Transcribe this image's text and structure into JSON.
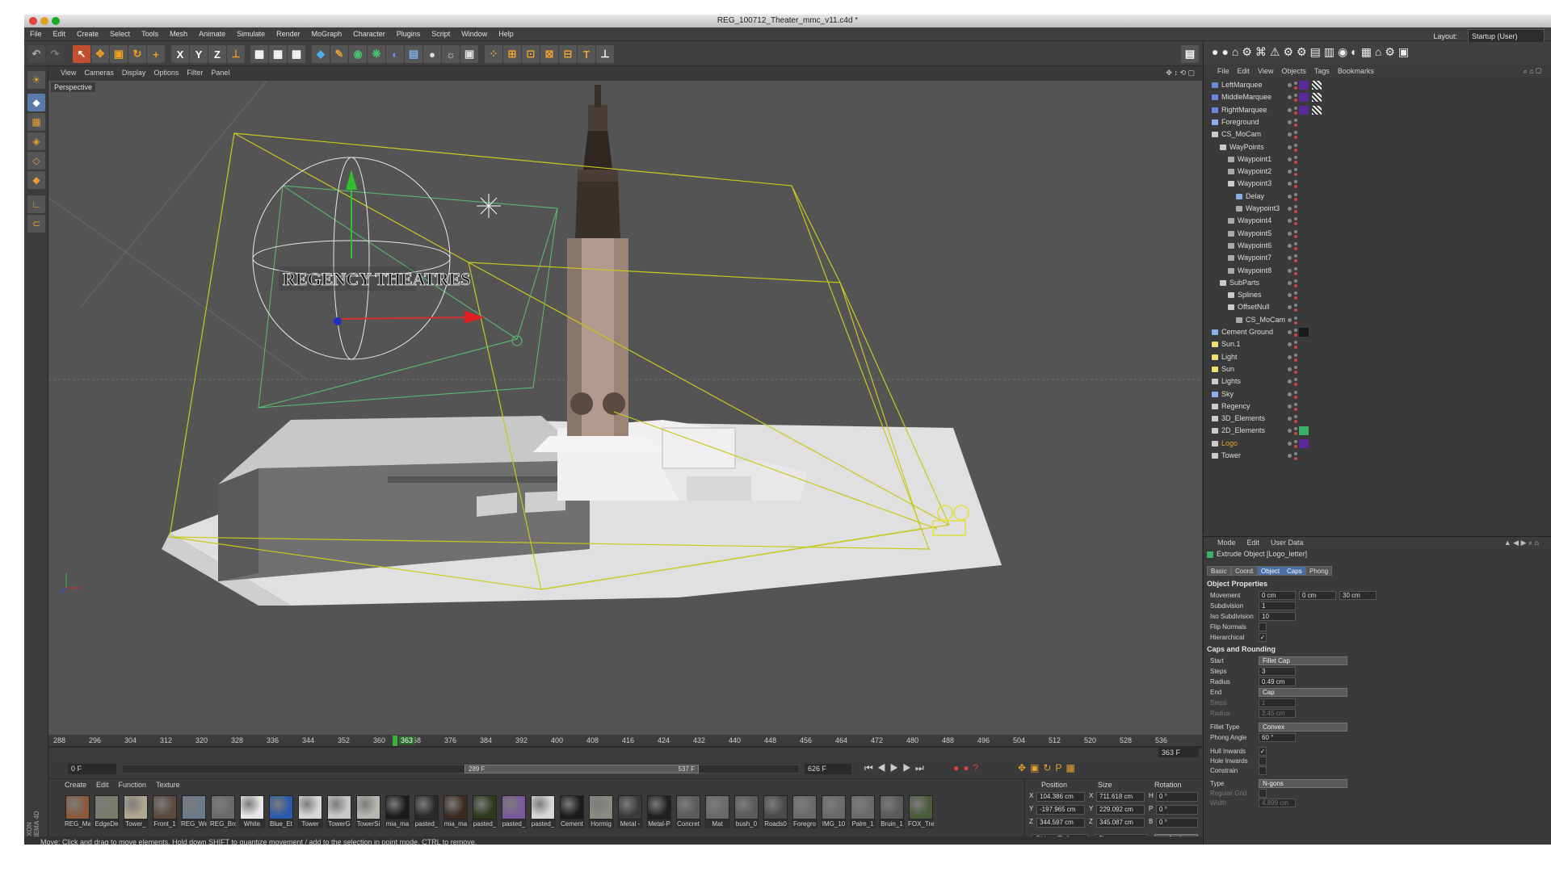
{
  "window": {
    "title": "REG_100712_Theater_mmc_v11.c4d *"
  },
  "menu": [
    "File",
    "Edit",
    "Create",
    "Select",
    "Tools",
    "Mesh",
    "Animate",
    "Simulate",
    "Render",
    "MoGraph",
    "Character",
    "Plugins",
    "Script",
    "Window",
    "Help"
  ],
  "layout": {
    "label": "Layout:",
    "value": "Startup (User)"
  },
  "toolbar": {
    "axis_x": "X",
    "axis_y": "Y",
    "axis_z": "Z",
    "text_tool": "T"
  },
  "viewport": {
    "menu": [
      "View",
      "Cameras",
      "Display",
      "Options",
      "Filter",
      "Panel"
    ],
    "label": "Perspective",
    "logo_text": "REGENCY THEATRES"
  },
  "timeline": {
    "ticks": [
      "288",
      "296",
      "304",
      "312",
      "320",
      "328",
      "336",
      "344",
      "352",
      "360",
      "368",
      "376",
      "384",
      "392",
      "400",
      "408",
      "416",
      "424",
      "432",
      "440",
      "448",
      "456",
      "464",
      "472",
      "480",
      "488",
      "496",
      "504",
      "512",
      "520",
      "528",
      "536"
    ],
    "current_marker": "363",
    "current_frame_display": "363 F",
    "frame_field": "0 F",
    "range_start": "289 F",
    "range_end": "537 F",
    "end_field": "626 F"
  },
  "materials": {
    "menu": [
      "Create",
      "Edit",
      "Function",
      "Texture"
    ],
    "brand": "MAXON CINEMA 4D",
    "items": [
      {
        "name": "REG_Ma",
        "color": "#8a5a3a"
      },
      {
        "name": "EdgeDe",
        "color": "#7a7a6a"
      },
      {
        "name": "Tower_",
        "color": "#b0a890"
      },
      {
        "name": "Front_1",
        "color": "#5a4a40"
      },
      {
        "name": "REG_We",
        "color": "#6a7a8a"
      },
      {
        "name": "REG_Brc",
        "color": "#6a6a6a"
      },
      {
        "name": "White",
        "color": "#e8e8e8"
      },
      {
        "name": "Blue_Et",
        "color": "#2a5aa8"
      },
      {
        "name": "Tower",
        "color": "#d8d8d8"
      },
      {
        "name": "TowerG",
        "color": "#c8c8c8"
      },
      {
        "name": "TowerSi",
        "color": "#b8b8b0"
      },
      {
        "name": "mia_ma",
        "color": "#1a1a1a"
      },
      {
        "name": "pasted_",
        "color": "#2a2a2a"
      },
      {
        "name": "mia_ma",
        "color": "#3a2a20"
      },
      {
        "name": "pasted_",
        "color": "#2a3a1a"
      },
      {
        "name": "pasted_",
        "color": "#7a5a9a"
      },
      {
        "name": "pasted_",
        "color": "#d8d8d8"
      },
      {
        "name": "Cement",
        "color": "#1a1a1a"
      },
      {
        "name": "Hormig",
        "color": "#8a8a80"
      },
      {
        "name": "Metal -",
        "color": "#3a3a3a"
      },
      {
        "name": "Metal-P",
        "color": "#202020"
      },
      {
        "name": "Concret",
        "color": "#5a5a5a"
      },
      {
        "name": "Mat",
        "color": "#6a6a6a"
      },
      {
        "name": "bush_0",
        "color": "#5a5a5a"
      },
      {
        "name": "Roads0",
        "color": "#4a4a4a"
      },
      {
        "name": "Foregro",
        "color": "#6a6a6a"
      },
      {
        "name": "IMG_10",
        "color": "#6a6a6a"
      },
      {
        "name": "Palm_1",
        "color": "#6a6a6a"
      },
      {
        "name": "Bruin_1",
        "color": "#5a5a5a"
      },
      {
        "name": "FOX_Tre",
        "color": "#4a5a3a"
      }
    ]
  },
  "coords": {
    "headers": [
      "Position",
      "Size",
      "Rotation"
    ],
    "rows": [
      {
        "axis": "X",
        "pos": "104.386 cm",
        "size_axis": "X",
        "size": "711.618 cm",
        "rot_axis": "H",
        "rot": "0 °"
      },
      {
        "axis": "Y",
        "pos": "-197.965 cm",
        "size_axis": "Y",
        "size": "229.092 cm",
        "rot_axis": "P",
        "rot": "0 °"
      },
      {
        "axis": "Z",
        "pos": "344.597 cm",
        "size_axis": "Z",
        "size": "345.087 cm",
        "rot_axis": "B",
        "rot": "0 °"
      }
    ],
    "mode": "Object (Rel)",
    "size_mode": "Size",
    "apply": "Apply"
  },
  "status": "Move: Click and drag to move elements. Hold down SHIFT to quantize movement / add to the selection in point mode, CTRL to remove.",
  "objects": {
    "menu": [
      "File",
      "Edit",
      "View",
      "Objects",
      "Tags",
      "Bookmarks"
    ],
    "rows": [
      {
        "name": "LeftMarquee",
        "indent": 0,
        "color": "#dcdcdc"
      },
      {
        "name": "MiddleMarquee",
        "indent": 0,
        "color": "#dcdcdc"
      },
      {
        "name": "RightMarquee",
        "indent": 0,
        "color": "#dcdcdc"
      },
      {
        "name": "Foreground",
        "indent": 0,
        "color": "#dcdcdc"
      },
      {
        "name": "CS_MoCam",
        "indent": 0,
        "color": "#dcdcdc"
      },
      {
        "name": "WayPoints",
        "indent": 1,
        "color": "#dcdcdc"
      },
      {
        "name": "Waypoint1",
        "indent": 2,
        "color": "#dcdcdc"
      },
      {
        "name": "Waypoint2",
        "indent": 2,
        "color": "#dcdcdc"
      },
      {
        "name": "Waypoint3",
        "indent": 2,
        "color": "#dcdcdc"
      },
      {
        "name": "Delay",
        "indent": 3,
        "color": "#dcdcdc"
      },
      {
        "name": "Waypoint3",
        "indent": 3,
        "color": "#dcdcdc"
      },
      {
        "name": "Waypoint4",
        "indent": 2,
        "color": "#dcdcdc"
      },
      {
        "name": "Waypoint5",
        "indent": 2,
        "color": "#dcdcdc"
      },
      {
        "name": "Waypoint6",
        "indent": 2,
        "color": "#dcdcdc"
      },
      {
        "name": "Waypoint7",
        "indent": 2,
        "color": "#dcdcdc"
      },
      {
        "name": "Waypoint8",
        "indent": 2,
        "color": "#dcdcdc"
      },
      {
        "name": "SubParts",
        "indent": 1,
        "color": "#dcdcdc"
      },
      {
        "name": "Splines",
        "indent": 2,
        "color": "#dcdcdc"
      },
      {
        "name": "OffsetNull",
        "indent": 2,
        "color": "#dcdcdc"
      },
      {
        "name": "CS_MoCam",
        "indent": 3,
        "color": "#dcdcdc"
      },
      {
        "name": "Cement Ground",
        "indent": 0,
        "color": "#dcdcdc"
      },
      {
        "name": "Sun.1",
        "indent": 0,
        "color": "#dcdcdc"
      },
      {
        "name": "Light",
        "indent": 0,
        "color": "#dcdcdc"
      },
      {
        "name": "Sun",
        "indent": 0,
        "color": "#dcdcdc"
      },
      {
        "name": "Lights",
        "indent": 0,
        "color": "#dcdcdc"
      },
      {
        "name": "Sky",
        "indent": 0,
        "color": "#dcdcdc"
      },
      {
        "name": "Regency",
        "indent": 0,
        "color": "#dcdcdc"
      },
      {
        "name": "3D_Elements",
        "indent": 0,
        "color": "#dcdcdc"
      },
      {
        "name": "2D_Elements",
        "indent": 0,
        "color": "#dcdcdc"
      },
      {
        "name": "Logo",
        "indent": 0,
        "color": "#e8a030"
      },
      {
        "name": "Tower",
        "indent": 0,
        "color": "#dcdcdc"
      }
    ]
  },
  "attributes": {
    "menu": [
      "Mode",
      "Edit",
      "User Data"
    ],
    "object_title": "Extrude Object [Logo_letter]",
    "tabs": [
      "Basic",
      "Coord.",
      "Object",
      "Caps",
      "Phong"
    ],
    "section1": "Object Properties",
    "movement_label": "Movement",
    "movement": [
      "0 cm",
      "0 cm",
      "30 cm"
    ],
    "subdivision_label": "Subdivision",
    "subdivision": "1",
    "iso_label": "Iso Subdivision",
    "iso": "10",
    "flip_label": "Flip Normals",
    "hier_label": "Hierarchical",
    "section2": "Caps and Rounding",
    "start_label": "Start",
    "start": "Fillet Cap",
    "steps_label": "Steps",
    "steps": "3",
    "radius_label": "Radius",
    "radius": "0.49 cm",
    "end_label": "End",
    "end": "Cap",
    "steps2_label": "Steps",
    "steps2": "1",
    "radius2_label": "Radius",
    "radius2": "2.45 cm",
    "fillet_type_label": "Fillet Type",
    "fillet_type": "Convex",
    "phong_label": "Phong Angle",
    "phong": "60 °",
    "hull_label": "Hull Inwards",
    "hole_label": "Hole Inwards",
    "constrain_label": "Constrain",
    "type_label": "Type",
    "type": "N-gons",
    "grid_label": "Regular Grid",
    "width_label": "Width",
    "width": "4.899 cm"
  }
}
